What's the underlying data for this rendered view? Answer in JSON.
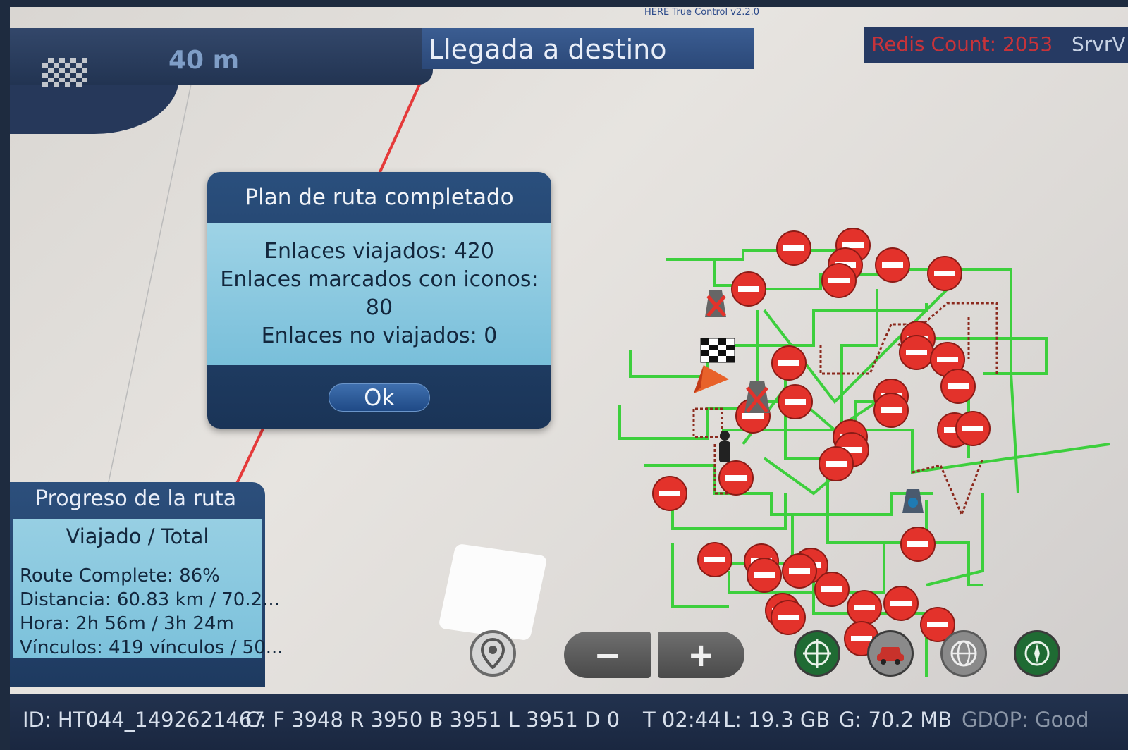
{
  "app_title": "HERE True Control v2.2.0",
  "header": {
    "flag_icon": "checkered-flag-icon",
    "distance": "40 m",
    "destination": "Llegada a destino",
    "redis": "Redis Count: 2053",
    "server": "SrvrV"
  },
  "dialog": {
    "title": "Plan de ruta completado",
    "line1": "Enlaces viajados: 420",
    "line2": "Enlaces marcados con iconos:",
    "line3": "80",
    "line4": "Enlaces no viajados: 0",
    "ok_label": "Ok"
  },
  "progress": {
    "title": "Progreso de la ruta",
    "subheading": "Viajado / Total",
    "route_complete": "Route Complete: 86%",
    "distance": "Distancia: 60.83 km / 70.2...",
    "time": "Hora: 2h 56m / 3h 24m",
    "links": "Vínculos: 419 vínculos / 50..."
  },
  "status": {
    "id": "ID: HT044_1492621467",
    "counts": "C: F 3948 R 3950 B 3951 L 3951 D 0",
    "time": "T 02:44",
    "local": "L:  19.3 GB",
    "gps": "G:  70.2 MB",
    "gdop": "GDOP: Good"
  },
  "controls": {
    "location": "location-pin-icon",
    "zoom_out": "−",
    "zoom_in": "+",
    "center": "crosshair-icon",
    "vehicle": "car-icon",
    "globe": "globe-icon",
    "compass": "compass-icon"
  },
  "colors": {
    "route": "#e53a3a",
    "links_traveled": "#3dcf3d",
    "links_dashed": "#8b2a1e",
    "no_entry": "#e3322b",
    "panel_dark": "#223452",
    "panel_light": "#8fcbe1"
  }
}
